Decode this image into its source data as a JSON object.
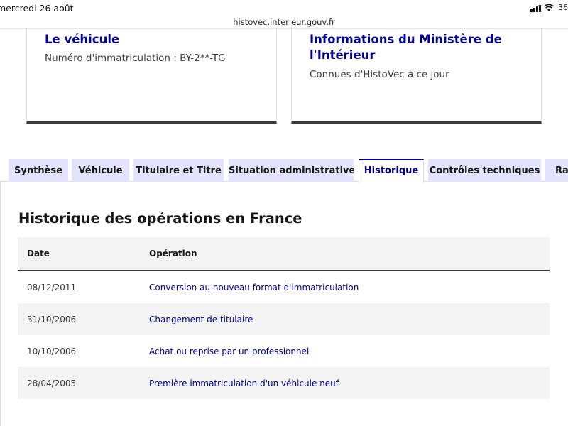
{
  "status_bar": {
    "date": "mercredi 26 août",
    "url": "histovec.interieur.gouv.fr",
    "battery": "36"
  },
  "cards": [
    {
      "title": "Le véhicule",
      "subtitle": "Numéro d'immatriculation : BY-2**-TG"
    },
    {
      "title": "Informations du Ministère de l'Intérieur",
      "subtitle": "Connues d'HistoVec à ce jour"
    }
  ],
  "tabs": [
    {
      "label": "Synthèse",
      "active": false
    },
    {
      "label": "Véhicule",
      "active": false
    },
    {
      "label": "Titulaire et Titre",
      "active": false
    },
    {
      "label": "Situation administrative",
      "active": false
    },
    {
      "label": "Historique",
      "active": true
    },
    {
      "label": "Contrôles techniques",
      "active": false
    },
    {
      "label": "Rap",
      "active": false
    }
  ],
  "section_title": "Historique des opérations en France",
  "history_table": {
    "headers": [
      "Date",
      "Opération"
    ],
    "rows": [
      {
        "date": "08/12/2011",
        "operation": "Conversion au nouveau format d'immatriculation"
      },
      {
        "date": "31/10/2006",
        "operation": "Changement de titulaire"
      },
      {
        "date": "10/10/2006",
        "operation": "Achat ou reprise par un professionnel"
      },
      {
        "date": "28/04/2005",
        "operation": "Première immatriculation d'un véhicule neuf"
      }
    ]
  },
  "colors": {
    "accent": "#000091",
    "tab_bg": "#e3e3fd",
    "row_alt": "#f3f3f3"
  }
}
